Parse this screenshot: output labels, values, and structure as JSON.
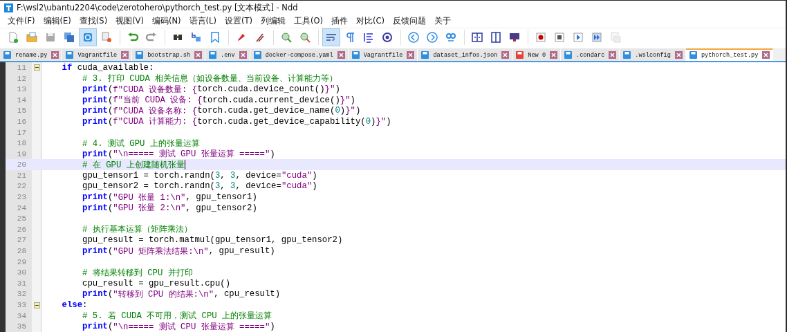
{
  "window": {
    "title": "F:\\wsl2\\ubantu2204\\code\\zerotohero\\pythorch_test.py [文本模式] - Ndd"
  },
  "menu": [
    "文件(F)",
    "编辑(E)",
    "查找(S)",
    "视图(V)",
    "编码(N)",
    "语言(L)",
    "设置(T)",
    "列编辑",
    "工具(O)",
    "插件",
    "对比(C)",
    "反馈问题",
    "关于"
  ],
  "toolbar": [
    {
      "kind": "new",
      "selected": false
    },
    {
      "kind": "open",
      "selected": false
    },
    {
      "kind": "save",
      "selected": false
    },
    {
      "kind": "save-all",
      "selected": false
    },
    {
      "kind": "sync",
      "selected": true
    },
    {
      "kind": "close",
      "selected": false
    },
    {
      "kind": "sep"
    },
    {
      "kind": "undo",
      "selected": false
    },
    {
      "kind": "redo",
      "selected": false
    },
    {
      "kind": "sep"
    },
    {
      "kind": "find",
      "selected": false
    },
    {
      "kind": "replace",
      "selected": false
    },
    {
      "kind": "bookmark",
      "selected": false
    },
    {
      "kind": "sep"
    },
    {
      "kind": "marker",
      "selected": false
    },
    {
      "kind": "clear",
      "selected": false
    },
    {
      "kind": "sep"
    },
    {
      "kind": "zoom-in",
      "selected": false
    },
    {
      "kind": "zoom-out",
      "selected": false
    },
    {
      "kind": "sep"
    },
    {
      "kind": "wrap",
      "selected": true
    },
    {
      "kind": "pilcrow",
      "selected": false
    },
    {
      "kind": "indent",
      "selected": false
    },
    {
      "kind": "target",
      "selected": false
    },
    {
      "kind": "sep"
    },
    {
      "kind": "back",
      "selected": false
    },
    {
      "kind": "forward",
      "selected": false
    },
    {
      "kind": "go",
      "selected": false
    },
    {
      "kind": "sep"
    },
    {
      "kind": "split-h",
      "selected": false
    },
    {
      "kind": "split-v",
      "selected": false
    },
    {
      "kind": "monitor",
      "selected": false
    },
    {
      "kind": "sep"
    },
    {
      "kind": "record",
      "selected": false
    },
    {
      "kind": "stop",
      "selected": false
    },
    {
      "kind": "play",
      "selected": false
    },
    {
      "kind": "play-many",
      "selected": false
    },
    {
      "kind": "macro",
      "selected": false,
      "disabled": true
    }
  ],
  "tabs": [
    {
      "label": "rename.py",
      "selected": false,
      "modified": false
    },
    {
      "label": "Vagrantfile",
      "selected": false,
      "modified": false
    },
    {
      "label": "bootstrap.sh",
      "selected": false,
      "modified": false
    },
    {
      "label": ".env",
      "selected": false,
      "modified": false
    },
    {
      "label": "docker-compose.yaml",
      "selected": false,
      "modified": false
    },
    {
      "label": "Vagrantfile",
      "selected": false,
      "modified": false
    },
    {
      "label": "dataset_infos.json",
      "selected": false,
      "modified": false
    },
    {
      "label": "New 0",
      "selected": false,
      "modified": true
    },
    {
      "label": ".condarc",
      "selected": false,
      "modified": false
    },
    {
      "label": ".wslconfig",
      "selected": false,
      "modified": false
    },
    {
      "label": "pythorch_test.py",
      "selected": true,
      "modified": false
    }
  ],
  "lines": [
    {
      "number": "11",
      "fold": true,
      "current": false,
      "tokens": [
        {
          "kind": "keyword",
          "text": "    if"
        },
        {
          "kind": "plain",
          "text": " cuda_available:"
        }
      ]
    },
    {
      "number": "12",
      "fold": false,
      "current": false,
      "tokens": [
        {
          "kind": "comment",
          "text": "        # 3. 打印 CUDA 相关信息（如设备数量、当前设备、计算能力等）"
        }
      ]
    },
    {
      "number": "13",
      "fold": false,
      "current": false,
      "tokens": [
        {
          "kind": "keyword",
          "text": "        print"
        },
        {
          "kind": "plain",
          "text": "("
        },
        {
          "kind": "string",
          "text": "f\"CUDA 设备数量: {"
        },
        {
          "kind": "plain",
          "text": "torch.cuda.device_count()"
        },
        {
          "kind": "string",
          "text": "}\""
        },
        {
          "kind": "plain",
          "text": ")"
        }
      ]
    },
    {
      "number": "14",
      "fold": false,
      "current": false,
      "tokens": [
        {
          "kind": "keyword",
          "text": "        print"
        },
        {
          "kind": "plain",
          "text": "("
        },
        {
          "kind": "string",
          "text": "f\"当前 CUDA 设备: {"
        },
        {
          "kind": "plain",
          "text": "torch.cuda.current_device()"
        },
        {
          "kind": "string",
          "text": "}\""
        },
        {
          "kind": "plain",
          "text": ")"
        }
      ]
    },
    {
      "number": "15",
      "fold": false,
      "current": false,
      "tokens": [
        {
          "kind": "keyword",
          "text": "        print"
        },
        {
          "kind": "plain",
          "text": "("
        },
        {
          "kind": "string",
          "text": "f\"CUDA 设备名称: {"
        },
        {
          "kind": "plain",
          "text": "torch.cuda.get_device_name("
        },
        {
          "kind": "number",
          "text": "0"
        },
        {
          "kind": "plain",
          "text": ")"
        },
        {
          "kind": "string",
          "text": "}\""
        },
        {
          "kind": "plain",
          "text": ")"
        }
      ]
    },
    {
      "number": "16",
      "fold": false,
      "current": false,
      "tokens": [
        {
          "kind": "keyword",
          "text": "        print"
        },
        {
          "kind": "plain",
          "text": "("
        },
        {
          "kind": "string",
          "text": "f\"CUDA 计算能力: {"
        },
        {
          "kind": "plain",
          "text": "torch.cuda.get_device_capability("
        },
        {
          "kind": "number",
          "text": "0"
        },
        {
          "kind": "plain",
          "text": ")"
        },
        {
          "kind": "string",
          "text": "}\""
        },
        {
          "kind": "plain",
          "text": ")"
        }
      ]
    },
    {
      "number": "17",
      "fold": false,
      "current": false
    },
    {
      "number": "18",
      "fold": false,
      "current": false,
      "tokens": [
        {
          "kind": "comment",
          "text": "        # 4. 测试 GPU 上的张量运算"
        }
      ]
    },
    {
      "number": "19",
      "fold": false,
      "current": false,
      "tokens": [
        {
          "kind": "keyword",
          "text": "        print"
        },
        {
          "kind": "plain",
          "text": "("
        },
        {
          "kind": "string",
          "text": "\"\\n===== 测试 GPU 张量运算 =====\""
        },
        {
          "kind": "plain",
          "text": ")"
        }
      ]
    },
    {
      "number": "20",
      "fold": false,
      "current": true,
      "tokens": [
        {
          "kind": "comment",
          "text": "        # 在 GPU 上创建随机张量"
        }
      ]
    },
    {
      "number": "21",
      "fold": false,
      "current": false,
      "tokens": [
        {
          "kind": "plain",
          "text": "        gpu_tensor1 = torch.randn("
        },
        {
          "kind": "number",
          "text": "3"
        },
        {
          "kind": "plain",
          "text": ", "
        },
        {
          "kind": "number",
          "text": "3"
        },
        {
          "kind": "plain",
          "text": ", device="
        },
        {
          "kind": "string",
          "text": "\"cuda\""
        },
        {
          "kind": "plain",
          "text": ")"
        }
      ]
    },
    {
      "number": "22",
      "fold": false,
      "current": false,
      "tokens": [
        {
          "kind": "plain",
          "text": "        gpu_tensor2 = torch.randn("
        },
        {
          "kind": "number",
          "text": "3"
        },
        {
          "kind": "plain",
          "text": ", "
        },
        {
          "kind": "number",
          "text": "3"
        },
        {
          "kind": "plain",
          "text": ", device="
        },
        {
          "kind": "string",
          "text": "\"cuda\""
        },
        {
          "kind": "plain",
          "text": ")"
        }
      ]
    },
    {
      "number": "23",
      "fold": false,
      "current": false,
      "tokens": [
        {
          "kind": "keyword",
          "text": "        print"
        },
        {
          "kind": "plain",
          "text": "("
        },
        {
          "kind": "string",
          "text": "\"GPU 张量 1:\\n\""
        },
        {
          "kind": "plain",
          "text": ", gpu_tensor1)"
        }
      ]
    },
    {
      "number": "24",
      "fold": false,
      "current": false,
      "tokens": [
        {
          "kind": "keyword",
          "text": "        print"
        },
        {
          "kind": "plain",
          "text": "("
        },
        {
          "kind": "string",
          "text": "\"GPU 张量 2:\\n\""
        },
        {
          "kind": "plain",
          "text": ", gpu_tensor2)"
        }
      ]
    },
    {
      "number": "25",
      "fold": false,
      "current": false
    },
    {
      "number": "26",
      "fold": false,
      "current": false,
      "tokens": [
        {
          "kind": "comment",
          "text": "        # 执行基本运算（矩阵乘法）"
        }
      ]
    },
    {
      "number": "27",
      "fold": false,
      "current": false,
      "tokens": [
        {
          "kind": "plain",
          "text": "        gpu_result = torch.matmul(gpu_tensor1, gpu_tensor2)"
        }
      ]
    },
    {
      "number": "28",
      "fold": false,
      "current": false,
      "tokens": [
        {
          "kind": "keyword",
          "text": "        print"
        },
        {
          "kind": "plain",
          "text": "("
        },
        {
          "kind": "string",
          "text": "\"GPU 矩阵乘法结果:\\n\""
        },
        {
          "kind": "plain",
          "text": ", gpu_result)"
        }
      ]
    },
    {
      "number": "29",
      "fold": false,
      "current": false
    },
    {
      "number": "30",
      "fold": false,
      "current": false,
      "tokens": [
        {
          "kind": "comment",
          "text": "        # 将结果转移到 CPU 并打印"
        }
      ]
    },
    {
      "number": "31",
      "fold": false,
      "current": false,
      "tokens": [
        {
          "kind": "plain",
          "text": "        cpu_result = gpu_result.cpu()"
        }
      ]
    },
    {
      "number": "32",
      "fold": false,
      "current": false,
      "tokens": [
        {
          "kind": "keyword",
          "text": "        print"
        },
        {
          "kind": "plain",
          "text": "("
        },
        {
          "kind": "string",
          "text": "\"转移到 CPU 的结果:\\n\""
        },
        {
          "kind": "plain",
          "text": ", cpu_result)"
        }
      ]
    },
    {
      "number": "33",
      "fold": true,
      "current": false,
      "tokens": [
        {
          "kind": "keyword",
          "text": "    else"
        },
        {
          "kind": "plain",
          "text": ":"
        }
      ]
    },
    {
      "number": "34",
      "fold": false,
      "current": false,
      "tokens": [
        {
          "kind": "comment",
          "text": "        # 5. 若 CUDA 不可用，测试 CPU 上的张量运算"
        }
      ]
    },
    {
      "number": "35",
      "fold": false,
      "current": false,
      "tokens": [
        {
          "kind": "keyword",
          "text": "        print"
        },
        {
          "kind": "plain",
          "text": "("
        },
        {
          "kind": "string",
          "text": "\"\\n===== 测试 CPU 张量运算 =====\""
        },
        {
          "kind": "plain",
          "text": ")"
        }
      ]
    }
  ]
}
